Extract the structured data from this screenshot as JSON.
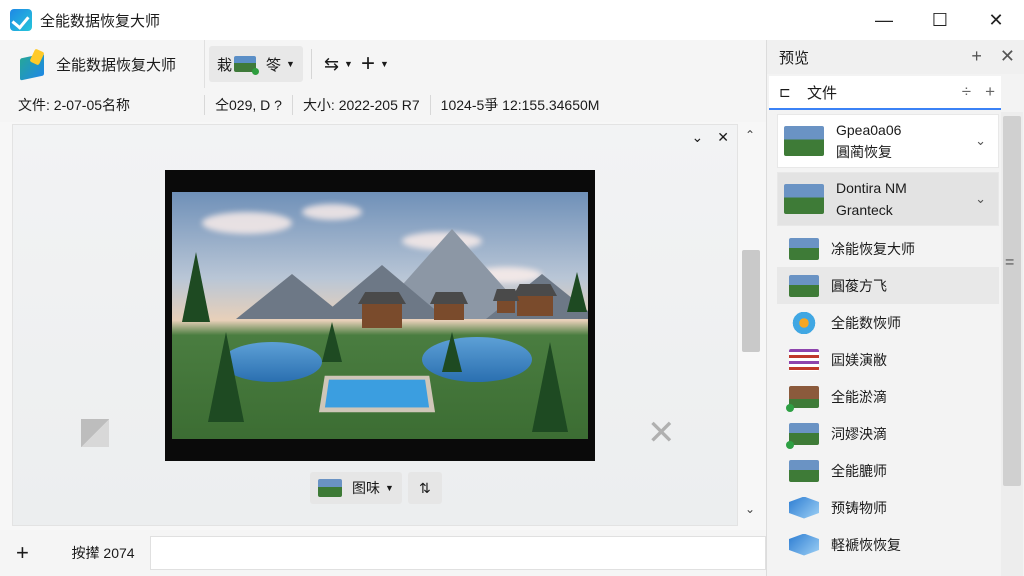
{
  "window": {
    "title": "全能数据恢复大师",
    "minimize": "—",
    "maximize": "☐",
    "close": "✕"
  },
  "toolbar": {
    "brand_label": "全能数据恢复大师",
    "group_a_label": "栽",
    "group_a_text": "笭",
    "group_b_icon": "⇆",
    "add_icon": "+"
  },
  "infobar": {
    "file_label": "文件:  2-07-05名称",
    "field2": "仝029, D ?",
    "size": "大小:  2022-205 R7",
    "timestamp": "1024-5爭 12:155.34650M"
  },
  "preview": {
    "collapse_icon": "⌄",
    "close_icon": "✕",
    "control_label": "图味",
    "swap_icon": "⇅"
  },
  "bottom": {
    "add_icon": "+",
    "label": "按撵 2074"
  },
  "right_panel": {
    "title": "预览",
    "tab_label": "文件",
    "items": [
      {
        "line1": "Gpea0a06",
        "line2": "圓蔺恢复"
      },
      {
        "line1": "Dontira NM",
        "line2": "Granteck"
      },
      {
        "label": "凃能恢复大师"
      },
      {
        "label": "圓葰方飞"
      },
      {
        "label": "全能数恢师"
      },
      {
        "label": "囸媄演敝"
      },
      {
        "label": "全能淤滴"
      },
      {
        "label": "泀嫪泱滴"
      },
      {
        "label": "全能膔师"
      },
      {
        "label": "预铸物师"
      },
      {
        "label": "軽褫恢恢复"
      }
    ]
  }
}
